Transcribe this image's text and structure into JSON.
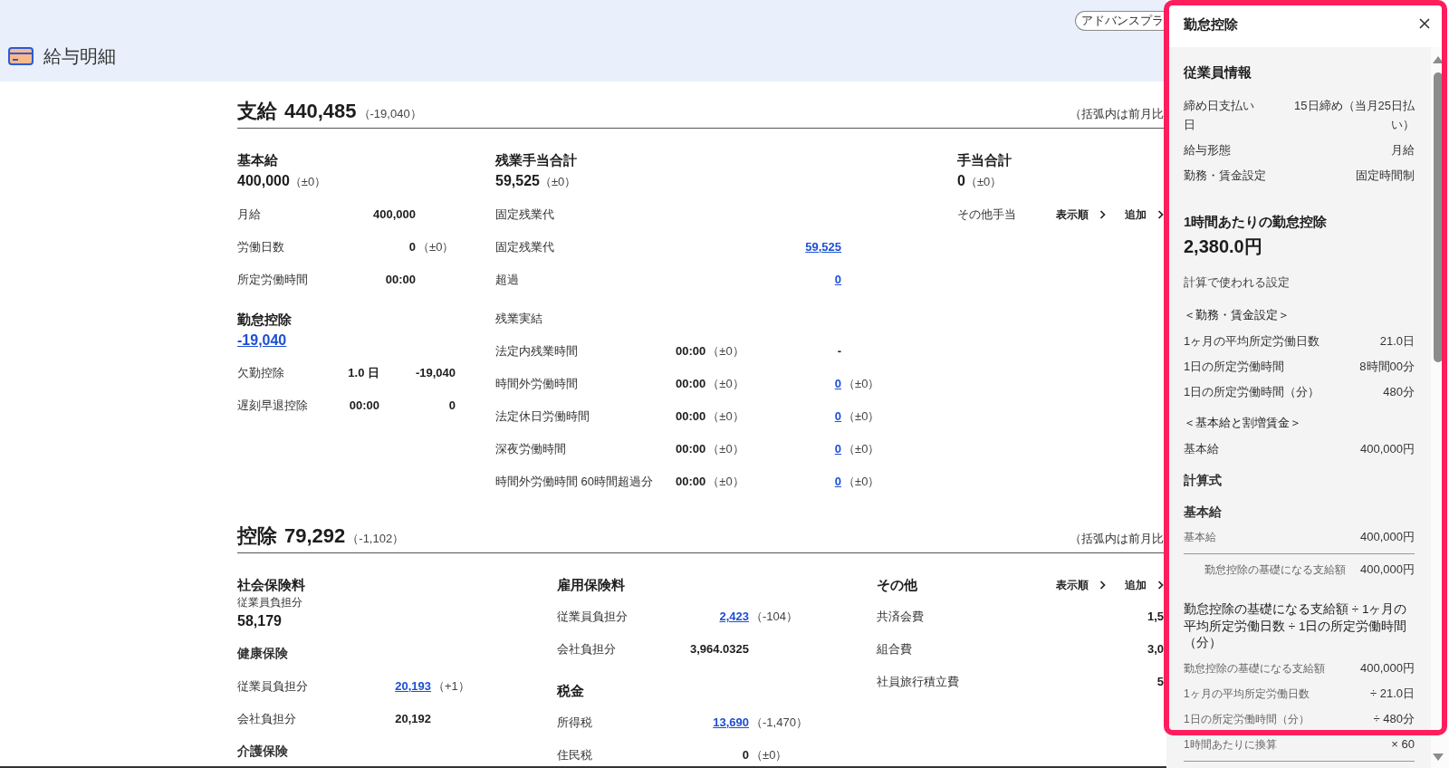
{
  "header": {
    "title": "給与明細",
    "plan_badge": "アドバンスプラ"
  },
  "sections": [
    {
      "title": "支給",
      "total": "440,485",
      "diff": "（-19,040）",
      "note": "（括弧内は前月比",
      "columns": [
        {
          "blocks": [
            {
              "kind": "total",
              "label": "基本給",
              "value": "400,000",
              "diff": "（±0）",
              "link": false
            },
            {
              "kind": "lines",
              "rows": [
                {
                  "label": "月給",
                  "value": "400,000",
                  "link": false
                },
                {
                  "label": "労働日数",
                  "value": "0",
                  "diff": "（±0）",
                  "link": false
                },
                {
                  "label": "所定労働時間",
                  "value": "00:00",
                  "link": false
                }
              ]
            },
            {
              "kind": "total",
              "label": "勤怠控除",
              "value": "-19,040",
              "link": true
            },
            {
              "kind": "pairs",
              "rows": [
                {
                  "label": "欠勤控除",
                  "quantity": "1.0 日",
                  "value": "-19,040"
                },
                {
                  "label": "遅刻早退控除",
                  "quantity": "00:00",
                  "value": "0"
                }
              ]
            }
          ]
        },
        {
          "blocks": [
            {
              "kind": "total",
              "label": "残業手当合計",
              "value": "59,525",
              "diff": "（±0）",
              "link": false
            },
            {
              "kind": "subheading",
              "text": "固定残業代"
            },
            {
              "kind": "lines",
              "rows": [
                {
                  "label": "固定残業代",
                  "value": "59,525",
                  "link": true
                },
                {
                  "label": "超過",
                  "value": "0",
                  "link": true
                }
              ]
            },
            {
              "kind": "subheading",
              "text": "残業実結"
            },
            {
              "kind": "hours",
              "rows": [
                {
                  "label": "法定内残業時間",
                  "hours": "00:00",
                  "hours_diff": "（±0）",
                  "value": "-",
                  "link": false
                },
                {
                  "label": "時間外労働時間",
                  "hours": "00:00",
                  "hours_diff": "（±0）",
                  "value": "0",
                  "diff": "（±0）",
                  "link": true
                },
                {
                  "label": "法定休日労働時間",
                  "hours": "00:00",
                  "hours_diff": "（±0）",
                  "value": "0",
                  "diff": "（±0）",
                  "link": true
                },
                {
                  "label": "深夜労働時間",
                  "hours": "00:00",
                  "hours_diff": "（±0）",
                  "value": "0",
                  "diff": "（±0）",
                  "link": true
                },
                {
                  "label": "時間外労働時間 60時間超過分",
                  "hours": "00:00",
                  "hours_diff": "（±0）",
                  "value": "0",
                  "diff": "（±0）",
                  "link": true
                }
              ]
            }
          ]
        },
        {
          "blocks": [
            {
              "kind": "total",
              "label": "手当合計",
              "value": "0",
              "diff": "（±0）",
              "link": false
            },
            {
              "kind": "subheading",
              "text": "その他手当",
              "actions": [
                "表示順",
                "追加"
              ]
            }
          ]
        }
      ]
    },
    {
      "title": "控除",
      "total": "79,292",
      "diff": "（-1,102）",
      "note": "（括弧内は前月比",
      "columns": [
        {
          "blocks": [
            {
              "kind": "total",
              "label": "社会保険料",
              "caption": "従業員負担分",
              "value": "58,179",
              "link": false
            },
            {
              "kind": "group_title",
              "text": "健康保険"
            },
            {
              "kind": "lines",
              "rows": [
                {
                  "label": "従業員負担分",
                  "value": "20,193",
                  "diff": "（+1）",
                  "link": true
                },
                {
                  "label": "会社負担分",
                  "value": "20,192",
                  "link": false
                }
              ]
            },
            {
              "kind": "group_title",
              "text": "介護保険"
            }
          ]
        },
        {
          "blocks": [
            {
              "kind": "heading",
              "text": "雇用保険料"
            },
            {
              "kind": "lines",
              "rows": [
                {
                  "label": "従業員負担分",
                  "value": "2,423",
                  "diff": "（-104）",
                  "link": true
                },
                {
                  "label": "会社負担分",
                  "value": "3,964.0325",
                  "link": false
                }
              ]
            },
            {
              "kind": "heading",
              "text": "税金"
            },
            {
              "kind": "lines",
              "rows": [
                {
                  "label": "所得税",
                  "value": "13,690",
                  "diff": "（-1,470）",
                  "link": true
                },
                {
                  "label": "住民税",
                  "value": "0",
                  "diff": "（±0）",
                  "link": false
                }
              ]
            }
          ]
        },
        {
          "blocks": [
            {
              "kind": "heading",
              "text": "その他",
              "actions": [
                "表示順",
                "追加"
              ]
            },
            {
              "kind": "lines",
              "rows": [
                {
                  "label": "共済会費",
                  "value": "1,5",
                  "link": false
                },
                {
                  "label": "組合費",
                  "value": "3,0",
                  "link": false
                },
                {
                  "label": "社員旅行積立費",
                  "value": "5",
                  "link": false
                }
              ]
            }
          ]
        }
      ]
    }
  ],
  "panel": {
    "title": "勤怠控除",
    "highlighted": true,
    "items": [
      {
        "kind": "heading",
        "text": "従業員情報"
      },
      {
        "kind": "row",
        "label": "締め日支払い日",
        "value": "15日締め（当月25日払い）"
      },
      {
        "kind": "row",
        "label": "給与形態",
        "value": "月給"
      },
      {
        "kind": "row",
        "label": "勤務・賃金設定",
        "value": "固定時間制"
      },
      {
        "kind": "heading",
        "text": "1時間あたりの勤怠控除"
      },
      {
        "kind": "amount",
        "text": "2,380.0円"
      },
      {
        "kind": "caption",
        "text": "計算で使われる設定"
      },
      {
        "kind": "link",
        "text": "＜勤務・賃金設定＞"
      },
      {
        "kind": "row",
        "label": "1ヶ月の平均所定労働日数",
        "value": "21.0日"
      },
      {
        "kind": "row",
        "label": "1日の所定労働時間",
        "value": "8時間00分"
      },
      {
        "kind": "row",
        "label": "1日の所定労働時間（分）",
        "value": "480分"
      },
      {
        "kind": "link",
        "text": "＜基本給と割増賃金＞"
      },
      {
        "kind": "row",
        "label": "基本給",
        "value": "400,000円"
      },
      {
        "kind": "subheading",
        "text": "計算式"
      },
      {
        "kind": "subheading",
        "text": "基本給"
      },
      {
        "kind": "small_row",
        "label": "基本給",
        "value": "400,000円"
      },
      {
        "kind": "result_row",
        "label": "勤怠控除の基礎になる支給額",
        "value": "400,000円"
      },
      {
        "kind": "formula",
        "text": "勤怠控除の基礎になる支給額 ÷ 1ヶ月の平均所定労働日数 ÷ 1日の所定労働時間（分）"
      },
      {
        "kind": "small_row",
        "label": "勤怠控除の基礎になる支給額",
        "value": "400,000円"
      },
      {
        "kind": "small_row",
        "label": "1ヶ月の平均所定労働日数",
        "value": "÷ 21.0日"
      },
      {
        "kind": "small_row",
        "label": "1日の所定労働時間（分）",
        "value": "÷ 480分"
      },
      {
        "kind": "small_row",
        "label": "1時間あたりに換算",
        "value": "× 60"
      }
    ]
  }
}
